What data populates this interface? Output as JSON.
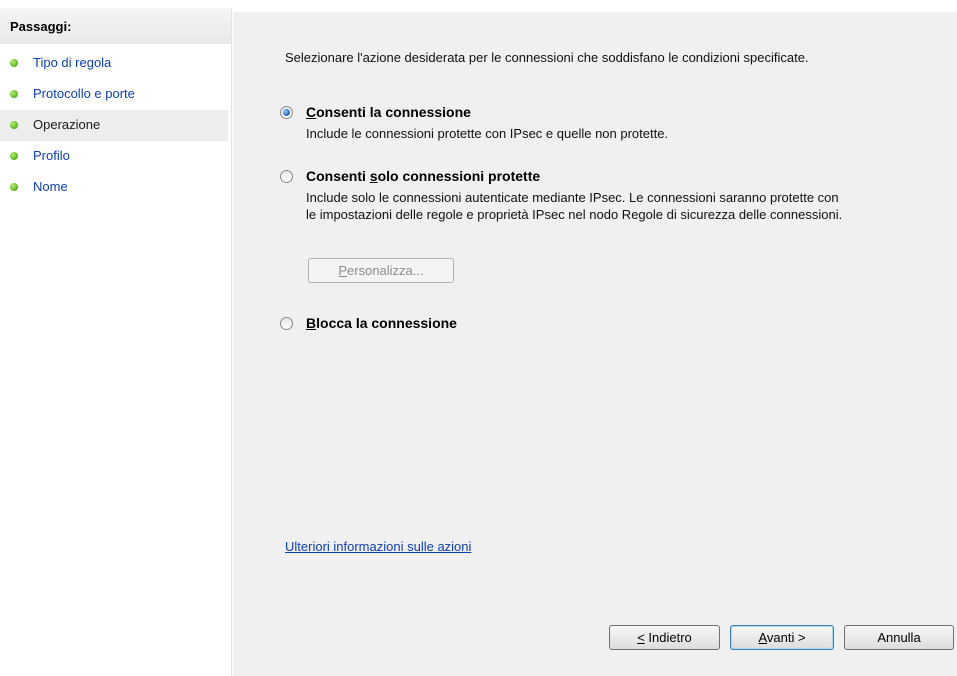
{
  "sidebar": {
    "title": "Passaggi:",
    "steps": [
      {
        "label": "Tipo di regola",
        "state": "completed"
      },
      {
        "label": "Protocollo e porte",
        "state": "completed"
      },
      {
        "label": "Operazione",
        "state": "current"
      },
      {
        "label": "Profilo",
        "state": "upcoming"
      },
      {
        "label": "Nome",
        "state": "upcoming"
      }
    ],
    "step_dot_color": "#69c12b"
  },
  "main": {
    "instruction": "Selezionare l'azione desiderata per le connessioni che soddisfano le condizioni specificate.",
    "options": [
      {
        "label_pre": "",
        "label_key": "C",
        "label_post": "onsenti la connessione",
        "description": [
          "Include le connessioni protette con IPsec e quelle non protette."
        ],
        "selected": true
      },
      {
        "label_pre": "Consenti ",
        "label_key": "s",
        "label_post": "olo connessioni protette",
        "description": [
          "Include solo le connessioni autenticate mediante IPsec. Le connessioni saranno protette con",
          "le impostazioni delle regole e proprietà IPsec nel nodo Regole di sicurezza delle connessioni."
        ],
        "selected": false
      },
      {
        "label_pre": "",
        "label_key": "B",
        "label_post": "locca la connessione",
        "description": [],
        "selected": false
      }
    ],
    "customize_button": {
      "label_key": "P",
      "label_rest": "ersonalizza...",
      "enabled": false
    },
    "more_info_link": "Ulteriori informazioni sulle azioni"
  },
  "footer": {
    "back_button": {
      "label_key": "<",
      "label_rest": " Indietro"
    },
    "next_button": {
      "label_key": "A",
      "label_rest": "vanti >"
    },
    "cancel_button": {
      "label": "Annulla"
    }
  },
  "colors": {
    "link": "#0f3fb5",
    "panel_background": "#f0f0f0",
    "radio_selected": "#2f6fc2",
    "default_button_border": "#3c7fb1"
  }
}
